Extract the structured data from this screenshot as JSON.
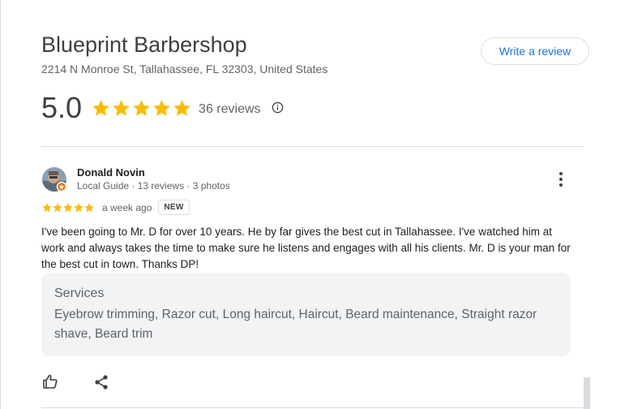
{
  "business": {
    "name": "Blueprint Barbershop",
    "address": "2214 N Monroe St, Tallahassee, FL 32303, United States",
    "write_review_label": "Write a review",
    "rating": "5.0",
    "rating_value": 5,
    "review_count_text": "36 reviews"
  },
  "review": {
    "author": "Donald Novin",
    "author_meta": "Local Guide · 13 reviews · 3 photos",
    "stars": 5,
    "time_ago": "a week ago",
    "badge": "NEW",
    "text": "I've been going to Mr. D for over 10 years. He by far gives the best cut in Tallahassee. I've watched him at work and always takes the time to make sure he listens and engages with all his clients. Mr. D is your man for the best cut in town. Thanks DP!",
    "services_title": "Services",
    "services": "Eyebrow trimming, Razor cut, Long haircut, Haircut, Beard maintenance, Straight razor shave, Beard trim"
  },
  "colors": {
    "star": "#fbbc04",
    "link": "#1a73e8",
    "local_guide_badge": "#e8710a"
  },
  "icons": {
    "info": "info-icon",
    "more": "more-vert-icon",
    "like": "thumb-up-icon",
    "share": "share-icon"
  }
}
